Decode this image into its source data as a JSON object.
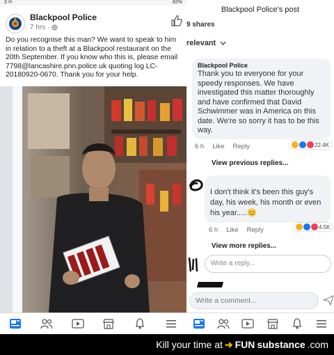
{
  "status_bar": {
    "left": "3 ⟳",
    "right": "82%"
  },
  "post": {
    "page_name": "Blackpool Police",
    "time": "7 hrs ·",
    "text": "Do you recognise this man? We want to speak to him in relation to a theft at a Blackpool restaurant on the 20th September. If you know who this is, please email 7798@lancashire.pnn.police.uk quoting log LC-20180920-0670. Thank you for your help."
  },
  "right_panel": {
    "title": "Blackpool Police's post",
    "shares": "9 shares",
    "sort": "relevant",
    "comment1": {
      "author": "Blackpool Police",
      "text": "Thank you to everyone for your speedy responses. We have investigated this matter thoroughly and have confirmed that David Schwimmer was in America on this date. We're so sorry it has to be this way.",
      "time": "6 h",
      "like": "Like",
      "reply": "Reply",
      "reactions": "22.4K"
    },
    "view_previous": "View previous replies...",
    "comment2": {
      "text": "I don't think it's been this guy's day, his week, his month or even his year.....😊",
      "time": "6 h",
      "like": "Like",
      "reply": "Reply",
      "reactions": "4.5K"
    },
    "view_more": "View more replies...",
    "reply_placeholder": "Write a reply...",
    "comment_placeholder": "Write a comment..."
  },
  "footer": {
    "text": "Kill your time at",
    "brand_fun": "FUN",
    "brand_sub": "substance",
    "brand_dom": ".com"
  },
  "colors": {
    "accent": "#1877f2",
    "reaction_blue": "#1877f2",
    "reaction_red": "#f33e58",
    "reaction_yellow": "#f7b125"
  }
}
